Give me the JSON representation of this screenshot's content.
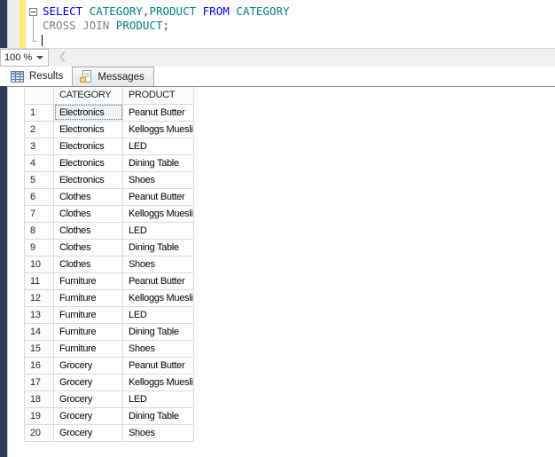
{
  "editor": {
    "code_lines": [
      [
        {
          "type": "keyword",
          "text": "SELECT"
        },
        {
          "type": "punct",
          "text": " "
        },
        {
          "type": "identifier",
          "text": "CATEGORY"
        },
        {
          "type": "punct",
          "text": ","
        },
        {
          "type": "identifier",
          "text": "PRODUCT"
        },
        {
          "type": "punct",
          "text": " "
        },
        {
          "type": "keyword",
          "text": "FROM"
        },
        {
          "type": "punct",
          "text": " "
        },
        {
          "type": "identifier",
          "text": "CATEGORY"
        }
      ],
      [
        {
          "type": "gray",
          "text": "CROSS JOIN"
        },
        {
          "type": "punct",
          "text": " "
        },
        {
          "type": "identifier",
          "text": "PRODUCT"
        },
        {
          "type": "punct",
          "text": ";"
        }
      ]
    ],
    "zoom_value": "100 %",
    "scroll_left_glyph": "❮"
  },
  "tabs": [
    {
      "label": "Results",
      "active": true
    },
    {
      "label": "Messages",
      "active": false
    }
  ],
  "grid": {
    "columns": [
      "CATEGORY",
      "PRODUCT"
    ],
    "rows": [
      [
        "1",
        "Electronics",
        "Peanut Butter"
      ],
      [
        "2",
        "Electronics",
        "Kelloggs Muesli"
      ],
      [
        "3",
        "Electronics",
        "LED"
      ],
      [
        "4",
        "Electronics",
        "Dining Table"
      ],
      [
        "5",
        "Electronics",
        "Shoes"
      ],
      [
        "6",
        "Clothes",
        "Peanut Butter"
      ],
      [
        "7",
        "Clothes",
        "Kelloggs Muesli"
      ],
      [
        "8",
        "Clothes",
        "LED"
      ],
      [
        "9",
        "Clothes",
        "Dining Table"
      ],
      [
        "10",
        "Clothes",
        "Shoes"
      ],
      [
        "11",
        "Furniture",
        "Peanut Butter"
      ],
      [
        "12",
        "Furniture",
        "Kelloggs Muesli"
      ],
      [
        "13",
        "Furniture",
        "LED"
      ],
      [
        "14",
        "Furniture",
        "Dining Table"
      ],
      [
        "15",
        "Furniture",
        "Shoes"
      ],
      [
        "16",
        "Grocery",
        "Peanut Butter"
      ],
      [
        "17",
        "Grocery",
        "Kelloggs Muesli"
      ],
      [
        "18",
        "Grocery",
        "LED"
      ],
      [
        "19",
        "Grocery",
        "Dining Table"
      ],
      [
        "20",
        "Grocery",
        "Shoes"
      ]
    ],
    "selected_cell": {
      "row": "1",
      "column": "CATEGORY"
    }
  },
  "colors": {
    "keyword": "#0000ff",
    "identifier": "#008080",
    "gray_text": "#808080",
    "change_bar": "#fde87a",
    "window_edge": "#2d3b5a"
  }
}
